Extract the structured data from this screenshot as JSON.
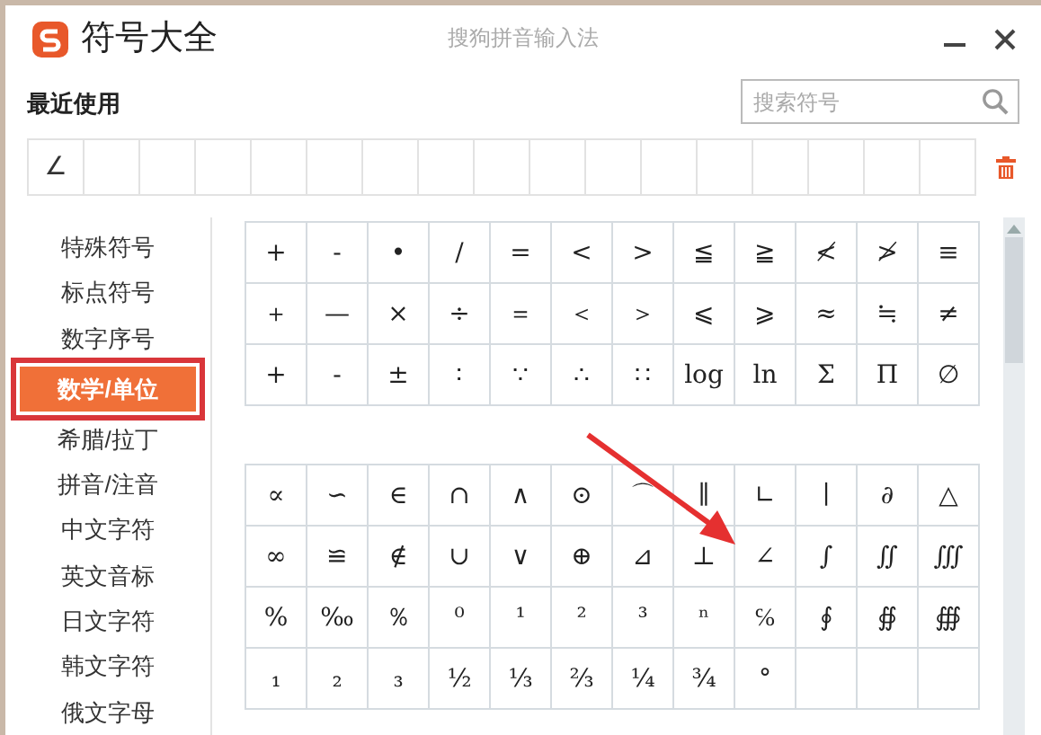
{
  "window": {
    "title": "符号大全",
    "app_name": "搜狗拼音输入法"
  },
  "recent": {
    "label": "最近使用",
    "symbols": [
      "∠"
    ]
  },
  "search": {
    "placeholder": "搜索符号"
  },
  "sidebar": {
    "items": [
      {
        "label": "特殊符号",
        "selected": false
      },
      {
        "label": "标点符号",
        "selected": false
      },
      {
        "label": "数字序号",
        "selected": false
      },
      {
        "label": "数学/单位",
        "selected": true
      },
      {
        "label": "希腊/拉丁",
        "selected": false
      },
      {
        "label": "拼音/注音",
        "selected": false
      },
      {
        "label": "中文字符",
        "selected": false
      },
      {
        "label": "英文音标",
        "selected": false
      },
      {
        "label": "日文字符",
        "selected": false
      },
      {
        "label": "韩文字符",
        "selected": false
      },
      {
        "label": "俄文字母",
        "selected": false
      }
    ]
  },
  "symbol_tables": [
    {
      "rows": [
        [
          "+",
          "-",
          "•",
          "/",
          "=",
          "<",
          ">",
          "≦",
          "≧",
          "≮",
          "≯",
          "≡"
        ],
        [
          "＋",
          "—",
          "×",
          "÷",
          "＝",
          "＜",
          "＞",
          "⩽",
          "⩾",
          "≈",
          "≒",
          "≠"
        ],
        [
          "+",
          "-",
          "±",
          "∶",
          "∵",
          "∴",
          "∷",
          "log",
          "ln",
          "Σ",
          "Π",
          "∅"
        ]
      ]
    },
    {
      "rows": [
        [
          "∝",
          "∽",
          "∈",
          "∩",
          "∧",
          "⊙",
          "⌒",
          "∥",
          "∟",
          "∣",
          "∂",
          "△"
        ],
        [
          "∞",
          "≌",
          "∉",
          "∪",
          "∨",
          "⊕",
          "⊿",
          "⊥",
          "∠",
          "∫",
          "∬",
          "∭"
        ],
        [
          "%",
          "‰",
          "％",
          "⁰",
          "¹",
          "²",
          "³",
          "ⁿ",
          "℅",
          "∮",
          "∯",
          "∰"
        ],
        [
          "₁",
          "₂",
          "₃",
          "½",
          "⅓",
          "⅔",
          "¼",
          "¾",
          "°"
        ]
      ]
    }
  ]
}
